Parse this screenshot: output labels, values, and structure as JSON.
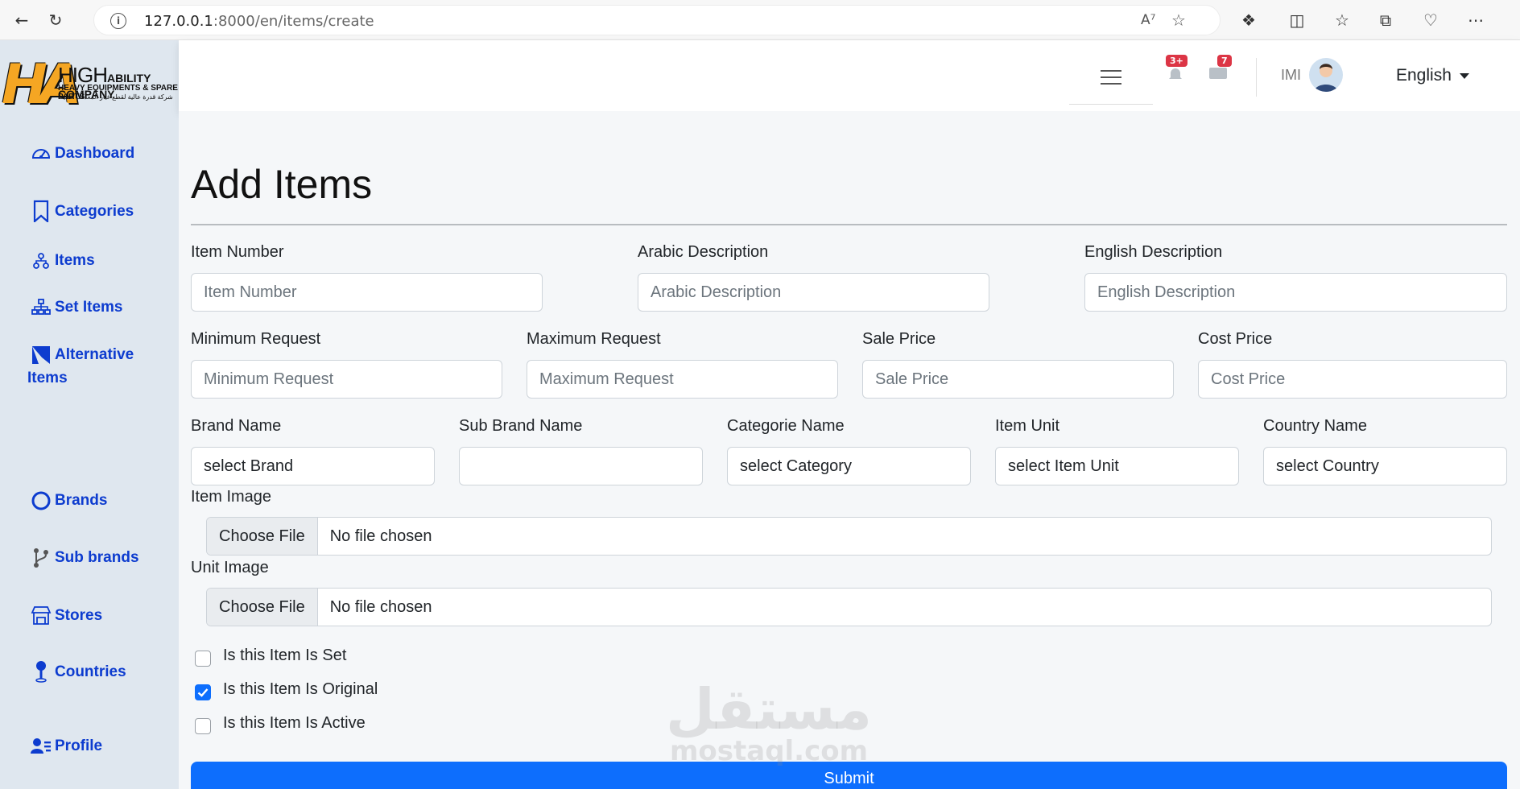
{
  "browser": {
    "url_host": "127.0.0.1",
    "url_rest": ":8000/en/items/create"
  },
  "logo": {
    "line1_a": "HIGH",
    "line1_b": "ABILITY COMPANY",
    "line2": "HEAVY EQUIPMENTS & SPARE PARTS",
    "line3": "شركة قدرة عالية لقطع غيار المعدات الثقيلة"
  },
  "sidebar": {
    "items": [
      {
        "label": "Dashboard",
        "icon": "dashboard-icon"
      },
      {
        "label": "Categories",
        "icon": "bookmark-icon"
      },
      {
        "label": "Items",
        "icon": "diagram-icon"
      },
      {
        "label": "Set Items",
        "icon": "hierarchy-icon"
      },
      {
        "label": "Alternative Items",
        "icon": "alternative-icon"
      },
      {
        "label": "Brands",
        "icon": "circle-icon"
      },
      {
        "label": "Sub brands",
        "icon": "branch-icon"
      },
      {
        "label": "Stores",
        "icon": "store-icon"
      },
      {
        "label": "Countries",
        "icon": "pin-icon"
      },
      {
        "label": "Profile",
        "icon": "user-list-icon"
      }
    ]
  },
  "header": {
    "notifications_badge": "3+",
    "messages_badge": "7",
    "user_initials": "IMI",
    "language": "English"
  },
  "main": {
    "title": "Add Items",
    "fields": {
      "item_number": {
        "label": "Item Number",
        "placeholder": "Item Number"
      },
      "arabic_description": {
        "label": "Arabic Description",
        "placeholder": "Arabic Description"
      },
      "english_description": {
        "label": "English Description",
        "placeholder": "English Description"
      },
      "minimum_request": {
        "label": "Minimum Request",
        "placeholder": "Minimum Request"
      },
      "maximum_request": {
        "label": "Maximum Request",
        "placeholder": "Maximum Request"
      },
      "sale_price": {
        "label": "Sale Price",
        "placeholder": "Sale Price"
      },
      "cost_price": {
        "label": "Cost Price",
        "placeholder": "Cost Price"
      },
      "brand_name": {
        "label": "Brand Name",
        "value": "select Brand"
      },
      "sub_brand_name": {
        "label": "Sub Brand Name",
        "value": ""
      },
      "categorie_name": {
        "label": "Categorie Name",
        "value": "select Category"
      },
      "item_unit": {
        "label": "Item Unit",
        "value": "select Item Unit"
      },
      "country_name": {
        "label": "Country Name",
        "value": "select Country"
      },
      "item_image": {
        "label": "Item Image",
        "button": "Choose File",
        "status": "No file chosen"
      },
      "unit_image": {
        "label": "Unit Image",
        "button": "Choose File",
        "status": "No file chosen"
      }
    },
    "checkboxes": [
      {
        "label": "Is this Item Is Set",
        "checked": false
      },
      {
        "label": "Is this Item Is Original",
        "checked": true
      },
      {
        "label": "Is this Item Is Active",
        "checked": false
      }
    ],
    "submit_label": "Submit"
  },
  "watermark": {
    "arabic": "مستقل",
    "latin": "mostaql.com"
  },
  "colors": {
    "sidebar_bg": "#dfe7ef",
    "nav_link": "#0d3ccf",
    "primary": "#0d6efd",
    "badge": "#dc3545"
  }
}
